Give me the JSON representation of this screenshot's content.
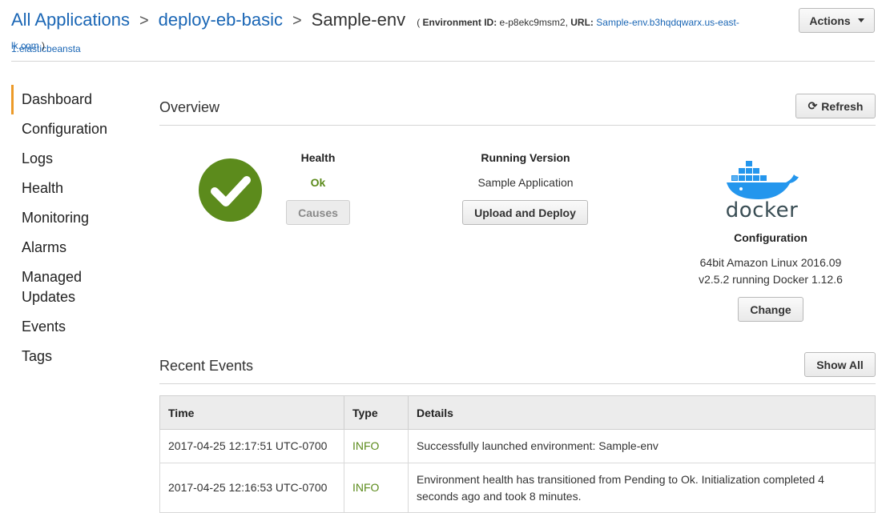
{
  "breadcrumb": {
    "root": "All Applications",
    "app": "deploy-eb-basic",
    "env": "Sample-env",
    "separator": ">",
    "env_id_label": "Environment ID:",
    "env_id_value": "e-p8ekc9msm2,",
    "url_label": "URL:",
    "url_value_line1": "Sample-env.b3hqdqwarx.us-east-1.elasticbeansta",
    "url_value_line2": "lk.com",
    "open_paren": "(",
    "close_paren": ")"
  },
  "header": {
    "actions_label": "Actions"
  },
  "sidebar": {
    "items": [
      {
        "label": "Dashboard",
        "active": true
      },
      {
        "label": "Configuration"
      },
      {
        "label": "Logs"
      },
      {
        "label": "Health"
      },
      {
        "label": "Monitoring"
      },
      {
        "label": "Alarms"
      },
      {
        "label": "Managed Updates"
      },
      {
        "label": "Events"
      },
      {
        "label": "Tags"
      }
    ]
  },
  "overview": {
    "title": "Overview",
    "refresh_label": "Refresh",
    "refresh_icon": "refresh-icon",
    "health": {
      "label": "Health",
      "status": "Ok",
      "status_color": "#5c8b1c",
      "icon": "checkmark-circle-icon",
      "causes_label": "Causes"
    },
    "running_version": {
      "label": "Running Version",
      "value": "Sample Application",
      "button_label": "Upload and Deploy"
    },
    "configuration": {
      "logo_text": "docker",
      "label": "Configuration",
      "line1": "64bit Amazon Linux 2016.09",
      "line2": "v2.5.2 running Docker 1.12.6",
      "button_label": "Change"
    }
  },
  "events": {
    "title": "Recent Events",
    "show_all_label": "Show All",
    "columns": [
      "Time",
      "Type",
      "Details"
    ],
    "rows": [
      {
        "time": "2017-04-25 12:17:51 UTC-0700",
        "type": "INFO",
        "details": "Successfully launched environment: Sample-env"
      },
      {
        "time": "2017-04-25 12:16:53 UTC-0700",
        "type": "INFO",
        "details": "Environment health has transitioned from Pending to Ok. Initialization completed 4 seconds ago and took 8 minutes."
      }
    ]
  },
  "colors": {
    "link": "#1a66b5",
    "active_tab_accent": "#ec9a29",
    "ok_green": "#5c8b1c",
    "docker_blue": "#2496ed"
  }
}
